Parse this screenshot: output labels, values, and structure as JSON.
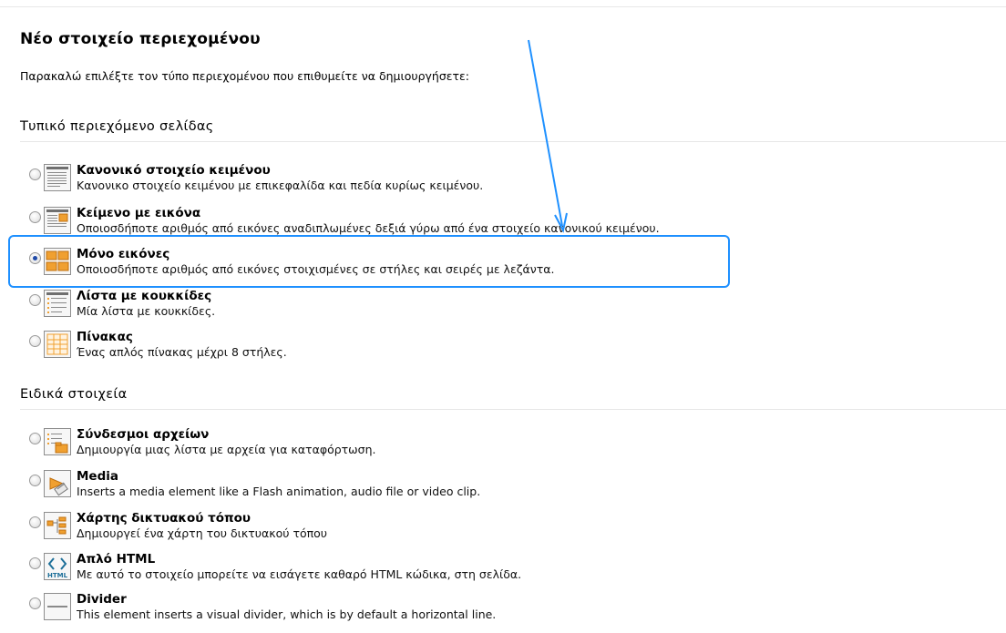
{
  "page": {
    "title": "Νέο στοιχείο περιεχομένου",
    "intro": "Παρακαλώ επιλέξτε τον τύπο περιεχομένου που επιθυμείτε να δημιουργήσετε:"
  },
  "sections": [
    {
      "header": "Τυπικό περιεχόμενο σελίδας",
      "items": [
        {
          "title": "Κανονικό στοιχείο κειμένου",
          "description": "Κανονικο στοιχείο κειμένου με επικεφαλίδα και πεδία κυρίως κειμένου.",
          "icon": "text-icon",
          "selected": false
        },
        {
          "title": "Κείμενο με εικόνα",
          "description": "Οποιοσδήποτε αριθμός από εικόνες αναδιπλωμένες δεξιά γύρω από ένα στοιχείο κανονικού κειμένου.",
          "icon": "text-image-icon",
          "selected": false
        },
        {
          "title": "Μόνο εικόνες",
          "description": "Οποιοσδήποτε αριθμός από εικόνες στοιχισμένες σε στήλες και σειρές με λεζάντα.",
          "icon": "images-icon",
          "selected": true
        },
        {
          "title": "Λίστα με κουκκίδες",
          "description": "Μία λίστα με κουκκίδες.",
          "icon": "bullet-list-icon",
          "selected": false
        },
        {
          "title": "Πίνακας",
          "description": "Ένας απλός πίνακας μέχρι 8 στήλες.",
          "icon": "table-icon",
          "selected": false
        }
      ]
    },
    {
      "header": "Ειδικά στοιχεία",
      "items": [
        {
          "title": "Σύνδεσμοι αρχείων",
          "description": "Δημιουργία μιας λίστα με αρχεία για καταφόρτωση.",
          "icon": "file-links-icon",
          "selected": false
        },
        {
          "title": "Media",
          "description": "Inserts a media element like a Flash animation, audio file or video clip.",
          "icon": "media-icon",
          "selected": false
        },
        {
          "title": "Χάρτης δικτυακού τόπου",
          "description": "Δημιουργεί ένα χάρτη του δικτυακού τόπου",
          "icon": "sitemap-icon",
          "selected": false
        },
        {
          "title": "Απλό HTML",
          "description": "Με αυτό το στοιχείο μπορείτε να εισάγετε καθαρό HTML κώδικα, στη σελίδα.",
          "icon": "html-icon",
          "selected": false
        },
        {
          "title": "Divider",
          "description": "This element inserts a visual divider, which is by default a horizontal line.",
          "icon": "divider-icon",
          "selected": false
        }
      ]
    }
  ],
  "icons": {
    "html_badge": "HTML"
  },
  "colors": {
    "annotation": "#1e90ff",
    "icon_orange": "#f0a030",
    "radio_selected": "#1f4aa8"
  }
}
